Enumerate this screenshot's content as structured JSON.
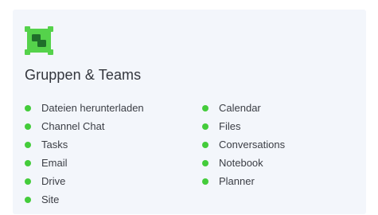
{
  "card": {
    "title": "Gruppen & Teams",
    "icon": "group-icon",
    "accent_color": "#44cc3b",
    "left_items": [
      {
        "label": "Dateien herunterladen"
      },
      {
        "label": "Channel Chat"
      },
      {
        "label": "Tasks"
      },
      {
        "label": "Email"
      },
      {
        "label": "Drive"
      },
      {
        "label": "Site"
      }
    ],
    "right_items": [
      {
        "label": "Calendar"
      },
      {
        "label": "Files"
      },
      {
        "label": "Conversations"
      },
      {
        "label": "Notebook"
      },
      {
        "label": "Planner"
      }
    ]
  }
}
